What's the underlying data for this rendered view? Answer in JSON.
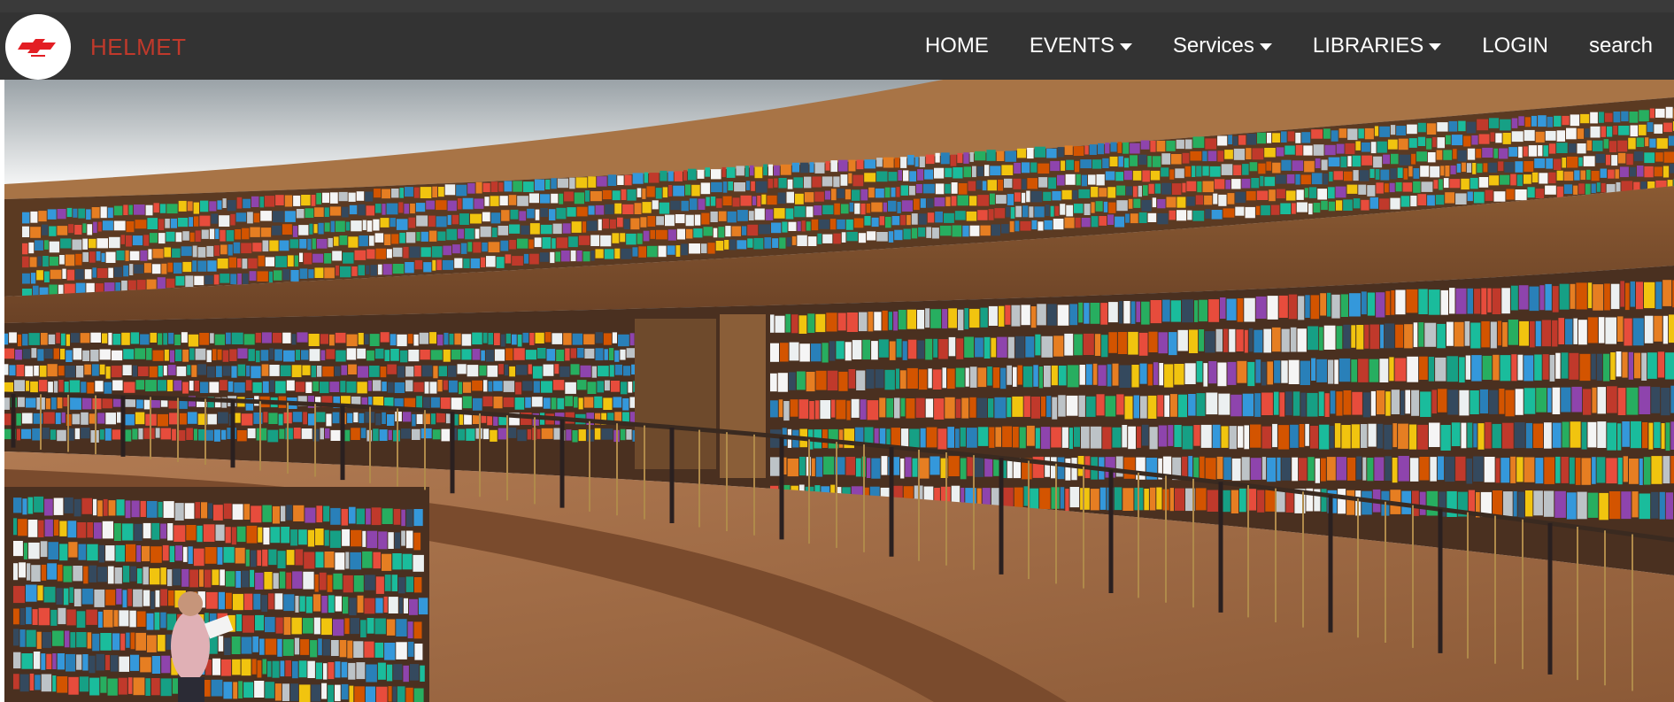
{
  "header": {
    "brand": "HELMET",
    "brand_color": "#c0392b",
    "bar_color": "#333333"
  },
  "nav": {
    "home": "HOME",
    "events": "EVENTS",
    "services": "Services",
    "libraries": "LIBRARIES",
    "login": "LOGIN",
    "search": "search"
  },
  "hero": {
    "image_icon": "library-rotunda-photo"
  }
}
